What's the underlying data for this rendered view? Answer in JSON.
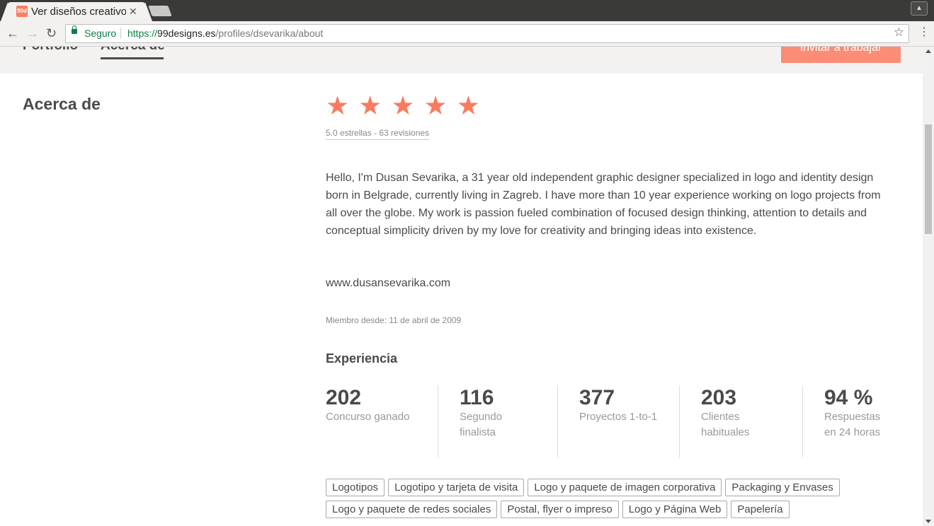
{
  "browser": {
    "tab_title": "Ver diseños creativos",
    "secure_label": "Seguro",
    "url_protocol": "https://",
    "url_host": "99designs.es",
    "url_path": "/profiles/dsevarika/about"
  },
  "page": {
    "tabs": [
      {
        "label": "Portfolio"
      },
      {
        "label": "Acerca de"
      }
    ],
    "invite_button": "Invitar a trabajar",
    "section_title": "Acerca de",
    "rating": {
      "stars": 5,
      "text": "5.0 estrellas - 63 revisiones"
    },
    "bio": "Hello, I'm Dusan Sevarika, a 31 year old independent graphic designer specialized in logo and identity design born in Belgrade, currently living in Zagreb. I have more than 10 year experience working on logo projects from all over the globe. My work is passion fueled combination of focused design thinking, attention to details and conceptual simplicity driven by my love for creativity and bringing ideas into existence.",
    "website": "www.dusansevarika.com",
    "member_since": "Miembro desde: 11 de abril de 2009",
    "experience_title": "Experiencia",
    "stats": [
      {
        "value": "202",
        "label": "Concurso ganado"
      },
      {
        "value": "116",
        "label": "Segundo finalista"
      },
      {
        "value": "377",
        "label": "Proyectos 1-to-1"
      },
      {
        "value": "203",
        "label": "Clientes habituales"
      },
      {
        "value": "94 %",
        "label": "Respuestas en 24 horas"
      }
    ],
    "tags": [
      "Logotipos",
      "Logotipo y tarjeta de visita",
      "Logo y paquete de imagen corporativa",
      "Packaging y Envases",
      "Logo y paquete de redes sociales",
      "Postal, flyer o impreso",
      "Logo y Página Web",
      "Papelería"
    ]
  },
  "colors": {
    "accent": "#fb7a5e",
    "button": "#fb8c75",
    "secure_green": "#0b8043"
  }
}
